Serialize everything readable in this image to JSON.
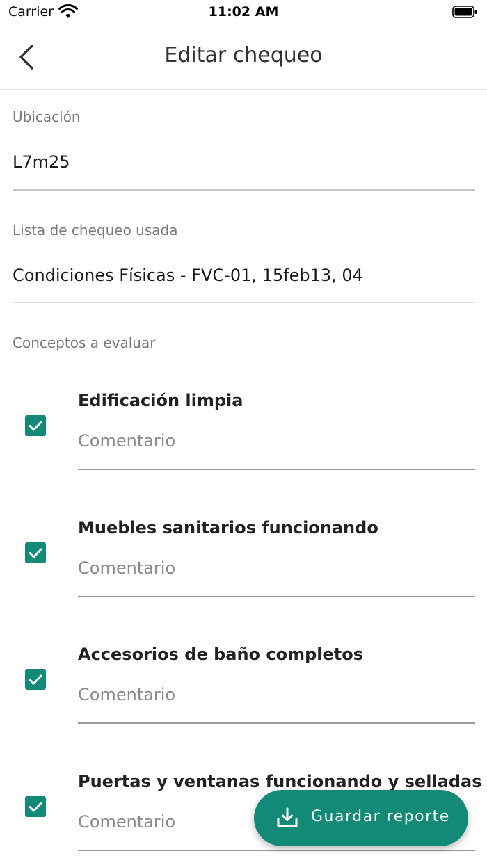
{
  "status_bar": {
    "carrier": "Carrier",
    "time": "11:02 AM",
    "wifi_icon": "wifi-icon",
    "battery_icon": "battery-icon"
  },
  "nav": {
    "title": "Editar chequeo",
    "back_icon": "chevron-left-icon"
  },
  "form": {
    "location": {
      "label": "Ubicación",
      "value": "L7m25"
    },
    "checklist": {
      "label": "Lista de chequeo usada",
      "value": "Condiciones Físicas - FVC-01, 15feb13, 04"
    },
    "concepts_label": "Conceptos a evaluar",
    "items": [
      {
        "title": "Edificación limpia",
        "checked": true,
        "comment_placeholder": "Comentario"
      },
      {
        "title": "Muebles sanitarios funcionando",
        "checked": true,
        "comment_placeholder": "Comentario"
      },
      {
        "title": "Accesorios de baño completos",
        "checked": true,
        "comment_placeholder": "Comentario"
      },
      {
        "title": "Puertas y ventanas funcionando y selladas",
        "checked": true,
        "comment_placeholder": "Comentario"
      }
    ]
  },
  "fab": {
    "label": "Guardar reporte",
    "icon": "download-icon"
  },
  "colors": {
    "accent": "#138a77",
    "label_gray": "#7a7a7a",
    "text": "#1a1a1a"
  }
}
